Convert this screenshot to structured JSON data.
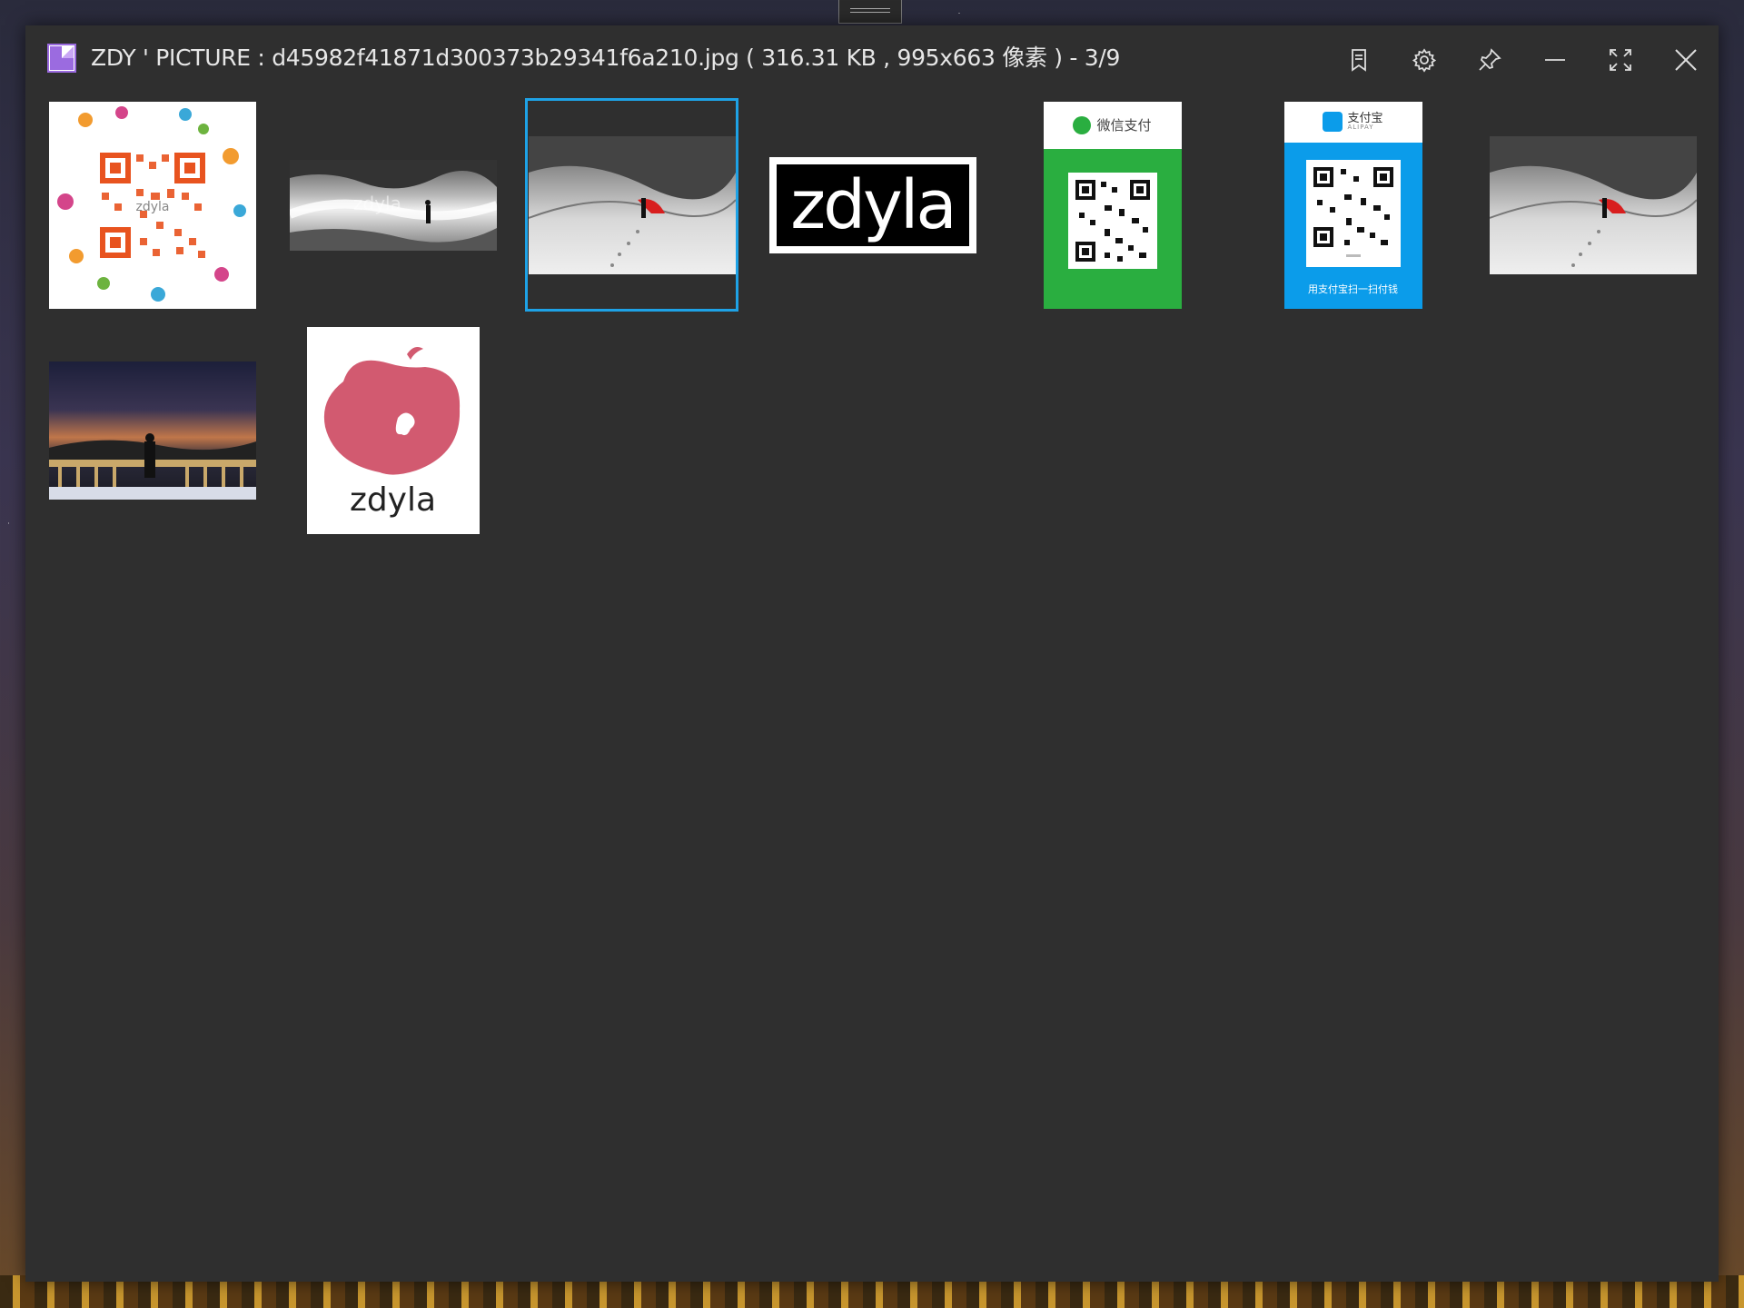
{
  "window": {
    "app_name": "ZDY ' PICTURE",
    "title": "ZDY ' PICTURE : d45982f41871d300373b29341f6a210.jpg ( 316.31 KB , 995x663 像素 ) - 3/9",
    "file_name": "d45982f41871d300373b29341f6a210.jpg",
    "file_size": "316.31 KB",
    "dimensions": "995x663",
    "dimensions_unit": "像素",
    "position": "3/9"
  },
  "controls": [
    {
      "name": "bookmark-icon"
    },
    {
      "name": "settings-gear-icon"
    },
    {
      "name": "pin-icon"
    },
    {
      "name": "minimize-icon"
    },
    {
      "name": "fullscreen-icon"
    },
    {
      "name": "close-icon"
    }
  ],
  "thumbnails": [
    {
      "index": 1,
      "kind": "colorful-qr-code",
      "caption": "zdyla"
    },
    {
      "index": 2,
      "kind": "snowy-river-photo",
      "caption": "zdyla"
    },
    {
      "index": 3,
      "kind": "desert-dune-photo",
      "selected": true
    },
    {
      "index": 4,
      "kind": "zdyla-wordmark",
      "caption": "zdyla"
    },
    {
      "index": 5,
      "kind": "wechat-pay-card",
      "caption": "微信支付"
    },
    {
      "index": 6,
      "kind": "alipay-card",
      "caption": "支付宝",
      "sub": "ALIPAY",
      "footer": "用支付宝扫一扫付钱"
    },
    {
      "index": 7,
      "kind": "desert-dune-photo"
    },
    {
      "index": 8,
      "kind": "night-lake-photo"
    },
    {
      "index": 9,
      "kind": "apple-logo",
      "caption": "zdyla"
    }
  ],
  "colors": {
    "accent": "#1ea2e6",
    "wechat": "#2aae40",
    "alipay": "#0b9cea",
    "window_bg": "#2f2f2f",
    "apple": "#d25a70"
  }
}
